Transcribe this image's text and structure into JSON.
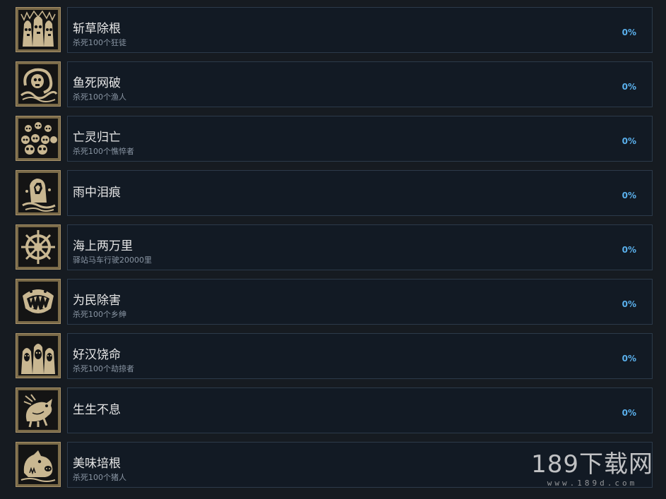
{
  "achievements": [
    {
      "title": "斩草除根",
      "desc": "杀死100个狂徒",
      "pct": "0%",
      "icon": "hooded-cultists-icon"
    },
    {
      "title": "鱼死网破",
      "desc": "杀死100个渔人",
      "pct": "0%",
      "icon": "fishman-skull-icon"
    },
    {
      "title": "亡灵归亡",
      "desc": "杀死100个憔悴者",
      "pct": "0%",
      "icon": "skull-pile-icon"
    },
    {
      "title": "雨中泪痕",
      "desc": "",
      "pct": "0%",
      "icon": "stone-hand-icon"
    },
    {
      "title": "海上两万里",
      "desc": "驿站马车行驶20000里",
      "pct": "0%",
      "icon": "ship-wheel-icon"
    },
    {
      "title": "为民除害",
      "desc": "杀死100个乡绅",
      "pct": "0%",
      "icon": "fanged-maw-icon"
    },
    {
      "title": "好汉饶命",
      "desc": "杀死100个劫掠者",
      "pct": "0%",
      "icon": "bandit-faces-icon"
    },
    {
      "title": "生生不息",
      "desc": "",
      "pct": "0%",
      "icon": "swine-creature-icon"
    },
    {
      "title": "美味培根",
      "desc": "杀死100个猪人",
      "pct": "",
      "icon": "pig-head-icon"
    }
  ],
  "watermark": {
    "main": "189下载网",
    "sub": "www.189d.com"
  }
}
